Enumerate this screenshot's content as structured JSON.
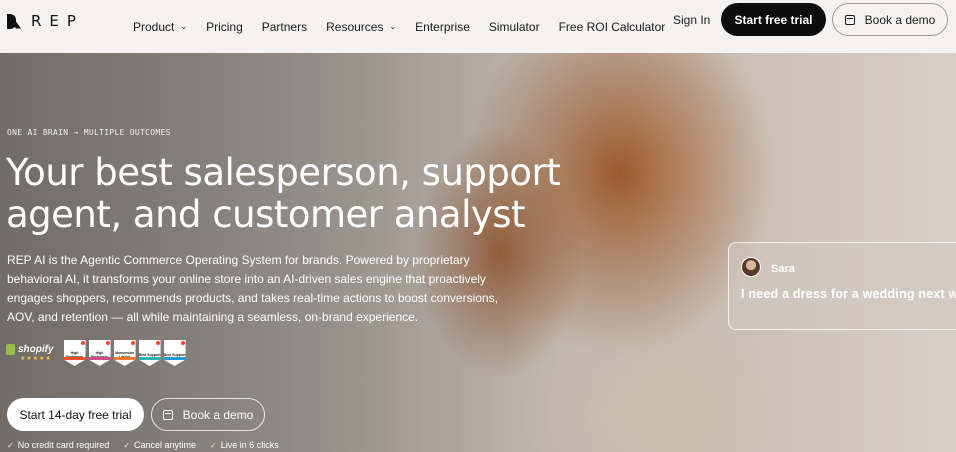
{
  "brand": {
    "name": "REP"
  },
  "nav": {
    "items": [
      {
        "label": "Product",
        "has_dropdown": true
      },
      {
        "label": "Pricing",
        "has_dropdown": false
      },
      {
        "label": "Partners",
        "has_dropdown": false
      },
      {
        "label": "Resources",
        "has_dropdown": true
      },
      {
        "label": "Enterprise",
        "has_dropdown": false
      },
      {
        "label": "Simulator",
        "has_dropdown": false
      },
      {
        "label": "Free ROI Calculator",
        "has_dropdown": false
      }
    ],
    "sign_in": "Sign In",
    "start_trial": "Start free trial",
    "book_demo": "Book a demo"
  },
  "hero": {
    "tagline": "ONE AI BRAIN → MULTIPLE OUTCOMES",
    "headline_line1": "Your best salesperson, support",
    "headline_line2": "agent, and customer analyst",
    "description": "REP AI is the Agentic Commerce Operating System for brands. Powered by proprietary behavioral AI, it transforms your online store into an AI-driven sales engine that proactively engages shoppers, recommends products, and takes real-time actions to boost conversions, AOV, and retention — all while maintaining a seamless, on-brand experience.",
    "shopify": {
      "label": "shopify",
      "rating_stars": "★★★★★"
    },
    "badges": [
      {
        "label": "High Performer",
        "color": "#ff492c"
      },
      {
        "label": "High Performer",
        "color": "#d04a8b"
      },
      {
        "label": "Momentum Leader",
        "color": "#f07b2b"
      },
      {
        "label": "Best Support",
        "color": "#24b8b0"
      },
      {
        "label": "Best Support",
        "color": "#1e9bd8"
      }
    ],
    "cta_primary": "Start 14-day free trial",
    "cta_secondary": "Book a demo",
    "checks": [
      "No credit card required",
      "Cancel anytime",
      "Live in 6 clicks"
    ]
  },
  "chat": {
    "name": "Sara",
    "message": "I need a dress for a wedding next we"
  },
  "colors": {
    "primary_button": "#0d0d0d",
    "nav_background": "#f5f3f1",
    "shopify_green": "#95bf47",
    "star_gold": "#f3c43b"
  }
}
